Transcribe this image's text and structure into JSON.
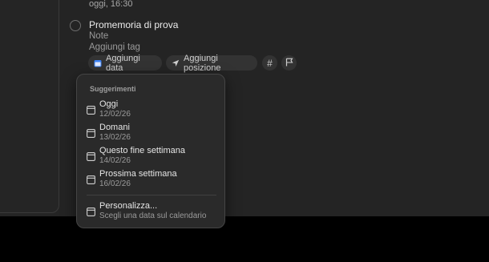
{
  "previous_item": {
    "date_text": "oggi, 16:30"
  },
  "reminder": {
    "title": "Promemoria di prova",
    "notes_placeholder": "Note",
    "tags_placeholder": "Aggiungi tag"
  },
  "chips": {
    "add_date": "Aggiungi data",
    "add_location": "Aggiungi posizione",
    "tag_symbol": "#"
  },
  "suggestions": {
    "header": "Suggerimenti",
    "items": [
      {
        "label": "Oggi",
        "date": "12/02/26"
      },
      {
        "label": "Domani",
        "date": "13/02/26"
      },
      {
        "label": "Questo fine settimana",
        "date": "14/02/26"
      },
      {
        "label": "Prossima settimana",
        "date": "16/02/26"
      }
    ],
    "custom": {
      "label": "Personalizza...",
      "sub": "Scegli una data sul calendario"
    }
  },
  "colors": {
    "background": "#242424",
    "popover": "#2a2a2a",
    "accent_calendar": "#3b82f6"
  }
}
